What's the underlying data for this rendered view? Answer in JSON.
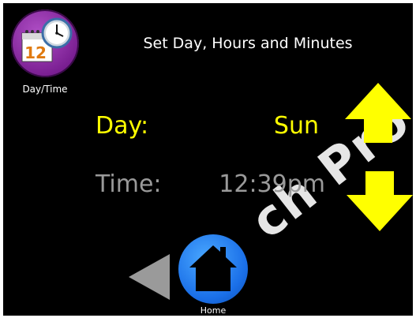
{
  "header": {
    "title": "Set Day, Hours and Minutes",
    "app_icon_label": "Day/Time",
    "calendar_number": "12"
  },
  "settings": {
    "day_label": "Day:",
    "day_value": "Sun",
    "time_label": "Time:",
    "time_value": "12:39pm"
  },
  "nav": {
    "home_label": "Home"
  },
  "colors": {
    "background": "#000000",
    "active_text": "#ffff00",
    "inactive_text": "#9a9a9a",
    "arrow": "#ffff00",
    "back_arrow": "#9a9a9a",
    "home_button": "#1a6fe8",
    "app_icon": "#7a1f92"
  },
  "icons": {
    "app": "calendar-clock-icon",
    "up": "arrow-up-icon",
    "down": "arrow-down-icon",
    "back": "back-arrow-icon",
    "home": "home-icon"
  }
}
